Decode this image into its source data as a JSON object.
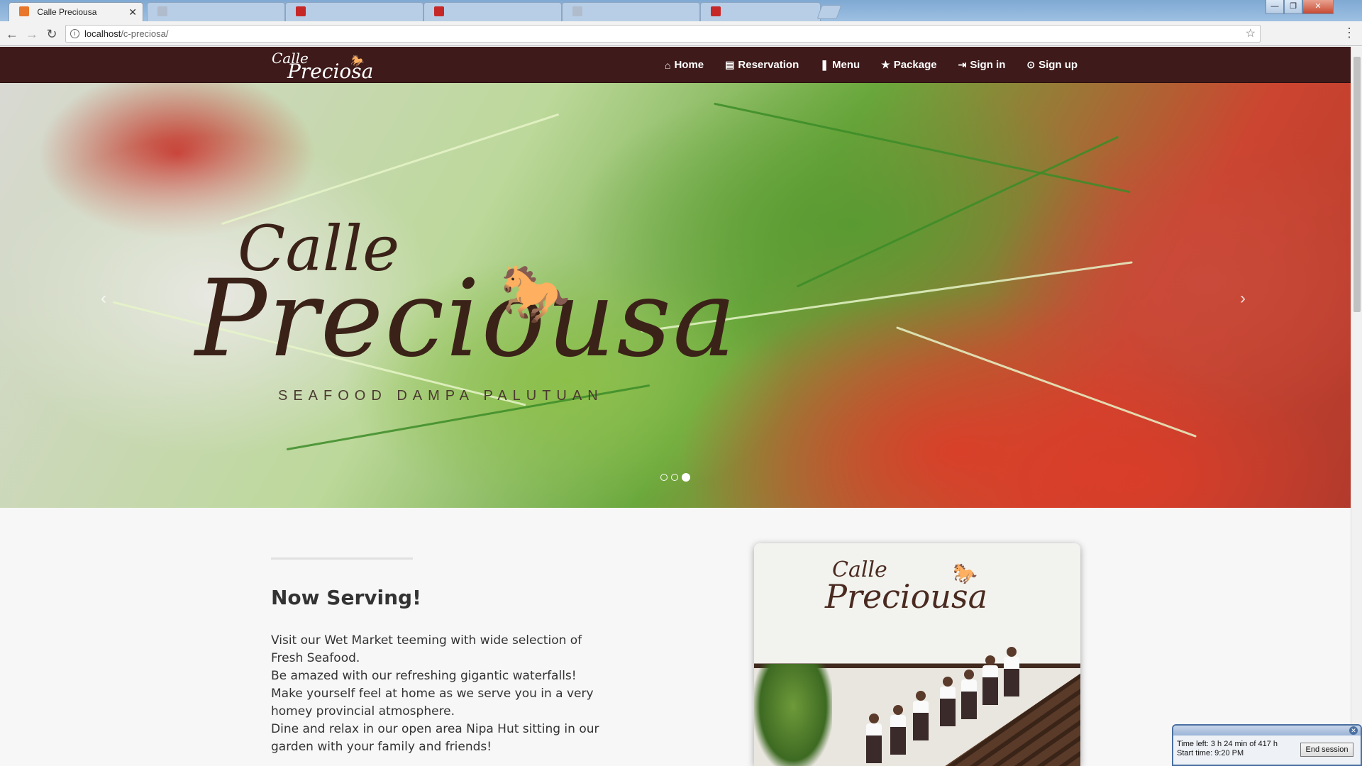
{
  "browser": {
    "tabs": [
      {
        "title": "Calle Preciousa",
        "active": true
      },
      {
        "title": "",
        "active": false
      },
      {
        "title": "",
        "active": false
      },
      {
        "title": "",
        "active": false
      },
      {
        "title": "",
        "active": false
      },
      {
        "title": "",
        "active": false
      }
    ],
    "url_host": "localhost",
    "url_path": "/c-preciosa/",
    "window_buttons": [
      "—",
      "❐",
      "✕"
    ]
  },
  "site": {
    "logo_line1": "Calle",
    "logo_line2": "Preciosa",
    "nav": [
      {
        "icon": "home-icon",
        "glyph": "⌂",
        "label": "Home"
      },
      {
        "icon": "document-icon",
        "glyph": "▤",
        "label": "Reservation"
      },
      {
        "icon": "bookmark-icon",
        "glyph": "❚",
        "label": "Menu"
      },
      {
        "icon": "star-icon",
        "glyph": "★",
        "label": "Package"
      },
      {
        "icon": "sign-in-icon",
        "glyph": "⇥",
        "label": "Sign in"
      },
      {
        "icon": "sign-up-icon",
        "glyph": "⊙",
        "label": "Sign up"
      }
    ]
  },
  "hero": {
    "logo_line1": "Calle",
    "logo_line2": "Preciousa",
    "tagline": "SEAFOOD DAMPA PALUTUAN",
    "slides_total": 3,
    "active_slide": 3,
    "prev_glyph": "‹",
    "next_glyph": "›"
  },
  "section": {
    "title": "Now Serving!",
    "paragraphs": [
      "Visit our Wet Market teeming with wide selection of Fresh Seafood.",
      "Be amazed with our refreshing gigantic waterfalls! Make yourself feel at home as we serve you in a very homey provincial atmosphere.",
      "Dine and relax in our open area Nipa Hut sitting in our garden with your family and friends!"
    ],
    "photo_sign_line1": "Calle",
    "photo_sign_line2": "Preciousa"
  },
  "session": {
    "time_left": "Time left: 3 h 24 min of 417 h",
    "start_time": "Start time: 9:20 PM",
    "end_button": "End session"
  },
  "colors": {
    "navbar": "#3e1a1a",
    "content_bg": "#f7f7f7"
  }
}
